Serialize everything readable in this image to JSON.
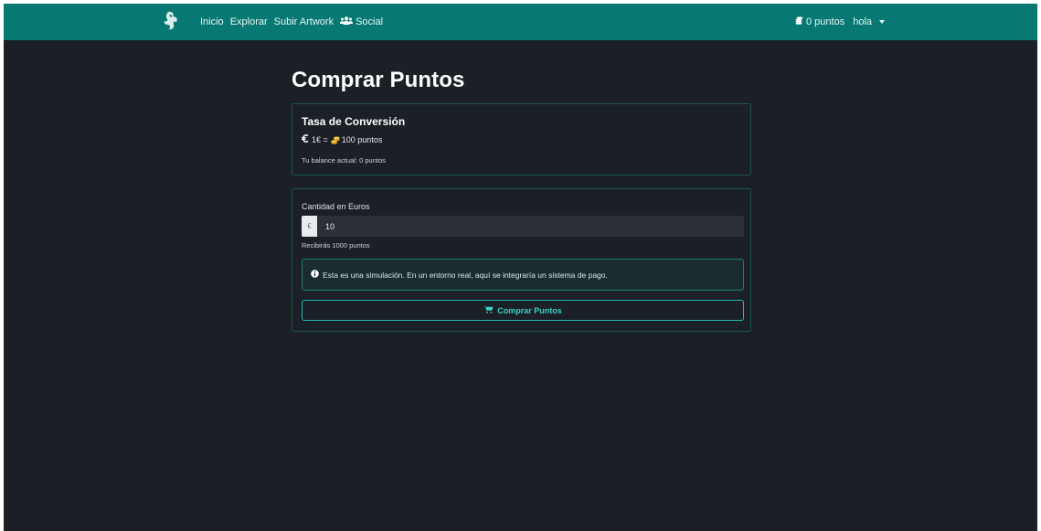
{
  "navbar": {
    "brand_icon": "dragon-logo-icon",
    "links": [
      {
        "label": "Inicio"
      },
      {
        "label": "Explorar"
      },
      {
        "label": "Subir Artwork"
      },
      {
        "label": "Social",
        "icon": "users-icon"
      }
    ],
    "points_label": "0 puntos",
    "user_label": "hola"
  },
  "page": {
    "title": "Comprar Puntos"
  },
  "rate_card": {
    "title": "Tasa de Conversión",
    "rate_left": "1€ =",
    "rate_right": "100 puntos",
    "balance": "Tu balance actual: 0 puntos"
  },
  "purchase_form": {
    "amount_label": "Cantidad en Euros",
    "currency_symbol": "€",
    "amount_value": "10",
    "receive_text": "Recibirás 1000 puntos",
    "notice": "Esta es una simulación. En un entorno real, aquí se integraría un sistema de pago.",
    "buy_label": "Comprar Puntos"
  },
  "colors": {
    "navbar": "#087872",
    "background": "#1b1f26",
    "accent": "#1fbab0"
  }
}
